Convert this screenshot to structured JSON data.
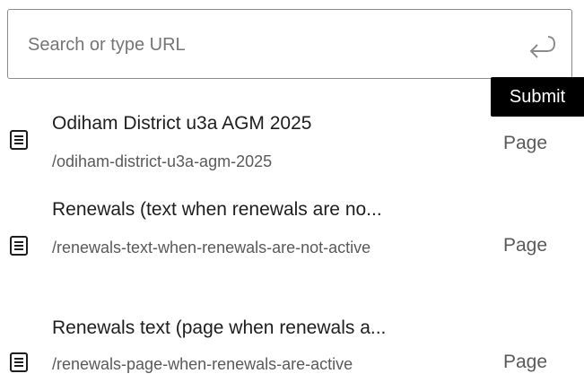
{
  "search": {
    "placeholder": "Search or type URL",
    "value": ""
  },
  "tooltip": {
    "label": "Submit"
  },
  "results": [
    {
      "title": "Odiham District u3a AGM 2025",
      "url": "/odiham-district-u3a-agm-2025",
      "kind": "Page"
    },
    {
      "title": "Renewals (text when renewals are no...",
      "url": "/renewals-text-when-renewals-are-not-active",
      "kind": "Page"
    },
    {
      "title": "Renewals text (page when renewals a...",
      "url": "/renewals-page-when-renewals-are-active",
      "kind": "Page"
    }
  ],
  "icons": {
    "submit": "enter-arrow-icon",
    "result": "page-document-icon"
  },
  "colors": {
    "border": "#8c8c8c",
    "tooltip_bg": "#000000",
    "text": "#1e1e1e",
    "muted": "#5a5a5a"
  }
}
